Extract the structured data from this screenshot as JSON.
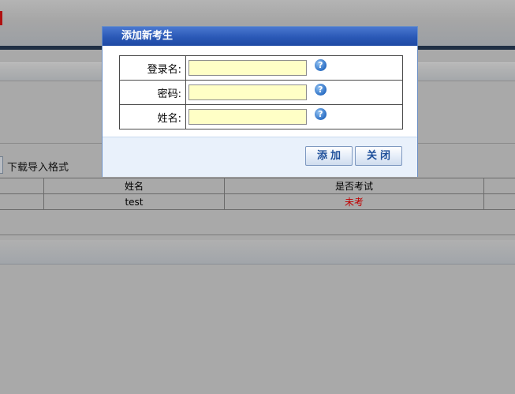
{
  "background": {
    "download_format_link": "下载导入格式",
    "table": {
      "columns": [
        "",
        "姓名",
        "是否考试",
        ""
      ],
      "rows": [
        {
          "name": "test",
          "exam_status": "未考"
        }
      ]
    }
  },
  "dialog": {
    "title": "添加新考生",
    "fields": [
      {
        "label": "登录名:",
        "value": "",
        "help": "?"
      },
      {
        "label": "密码:",
        "value": "",
        "help": "?"
      },
      {
        "label": "姓名:",
        "value": "",
        "help": "?"
      }
    ],
    "buttons": {
      "add": "添加",
      "close": "关闭"
    }
  },
  "colors": {
    "title_bar": "#2a58b6",
    "input_background": "#ffffc6",
    "not_taken_text": "#c00000",
    "overlay_gray": "#a9a9a9"
  }
}
